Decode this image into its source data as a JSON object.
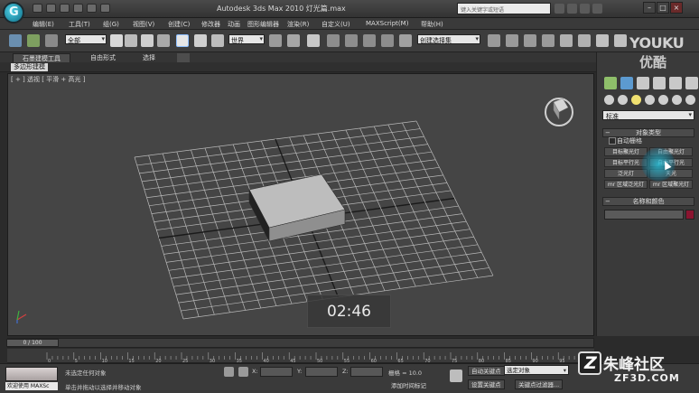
{
  "titlebar": {
    "title": "Autodesk 3ds Max  2010     灯光篇.max",
    "search_placeholder": "键入关键字或短语",
    "minimize": "–",
    "maximize": "□",
    "close": "×"
  },
  "menu": {
    "items": [
      "编辑(E)",
      "工具(T)",
      "组(G)",
      "视图(V)",
      "创建(C)",
      "修改器",
      "动画",
      "图形编辑器",
      "渲染(R)",
      "自定义(U)",
      "MAXScript(M)",
      "帮助(H)"
    ]
  },
  "toolbar": {
    "selection_filter": "全部",
    "reference_coord": "世界",
    "named_selection": "创建选择集"
  },
  "ribbon": {
    "tabs": [
      "石墨建模工具",
      "自由形式",
      "选择"
    ],
    "sub_chip": "多边形建模"
  },
  "viewport": {
    "label": "[ + ] 透视  [ 平滑 + 高光 ]",
    "timer": "02:46"
  },
  "command_panel": {
    "category_dropdown": "标准",
    "object_type_header": "对象类型",
    "auto_grid": "自动栅格",
    "light_buttons": [
      "目标聚光灯",
      "自由聚光灯",
      "目标平行光",
      "自由平行光",
      "泛光灯",
      "天光",
      "mr 区域泛光灯",
      "mr 区域聚光灯"
    ],
    "name_color_header": "名称和颜色",
    "swatch_color": "#8a1530"
  },
  "timeline": {
    "frame_readout": "0 / 100",
    "ticks": [
      "0",
      "5",
      "10",
      "15",
      "20",
      "25",
      "30",
      "35",
      "40",
      "45",
      "50",
      "55",
      "60",
      "65",
      "70",
      "75",
      "80",
      "85",
      "90",
      "95",
      "100"
    ]
  },
  "statusbar": {
    "welcome": "欢迎使用 MAXSc",
    "status_line1": "未选定任何对象",
    "status_line2": "单击并拖动以选择并移动对象",
    "x_label": "X:",
    "y_label": "Y:",
    "z_label": "Z:",
    "grid": "栅格 = 10.0",
    "add_time_tag": "添加时间标记",
    "auto_key": "自动关键点",
    "set_key": "设置关键点",
    "key_select": "选定对象",
    "key_filters": "关键点过滤器..."
  },
  "watermark": {
    "youku": "YOUKU",
    "youku_sub": "优酷",
    "site_name": "朱峰社区",
    "site_domain": "ZF3D.COM"
  }
}
